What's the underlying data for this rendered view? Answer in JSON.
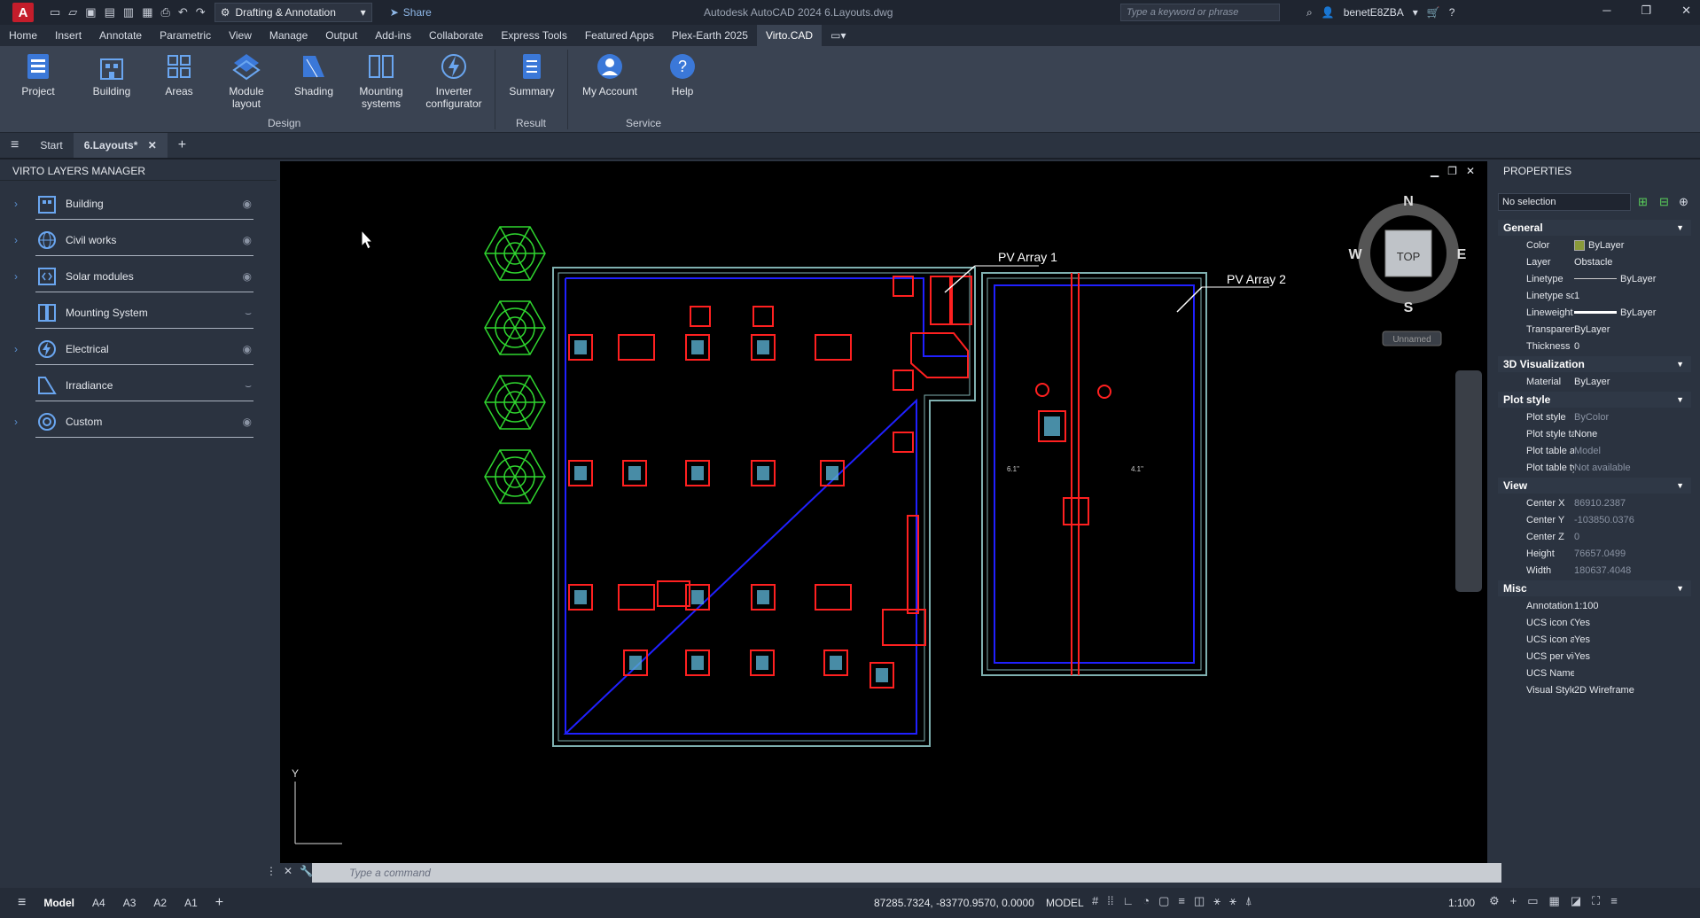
{
  "title_bar": {
    "logo_letter": "A",
    "workspace": "Drafting & Annotation",
    "share_label": "Share",
    "app_title": "Autodesk AutoCAD 2024   6.Layouts.dwg",
    "search_placeholder": "Type a keyword or phrase",
    "username": "benetE8ZBA"
  },
  "menu": [
    "Home",
    "Insert",
    "Annotate",
    "Parametric",
    "View",
    "Manage",
    "Output",
    "Add-ins",
    "Collaborate",
    "Express Tools",
    "Featured Apps",
    "Plex-Earth 2025",
    "Virto.CAD"
  ],
  "active_menu": "Virto.CAD",
  "ribbon": {
    "buttons": [
      {
        "label": "Project",
        "icon": "project-icon"
      },
      {
        "label": "Building",
        "icon": "building-icon"
      },
      {
        "label": "Areas",
        "icon": "areas-icon"
      },
      {
        "label": "Module\nlayout",
        "icon": "module-layout-icon"
      },
      {
        "label": "Shading",
        "icon": "shading-icon"
      },
      {
        "label": "Mounting\nsystems",
        "icon": "mounting-systems-icon"
      },
      {
        "label": "Inverter\nconfigurator",
        "icon": "inverter-icon"
      },
      {
        "label": "Summary",
        "icon": "summary-icon"
      },
      {
        "label": "My Account",
        "icon": "account-icon"
      },
      {
        "label": "Help",
        "icon": "help-icon"
      }
    ],
    "groups": [
      "Design",
      "Result",
      "Service"
    ]
  },
  "doc_tabs": {
    "start": "Start",
    "active": "6.Layouts*"
  },
  "layers_panel": {
    "title": "VIRTO LAYERS MANAGER",
    "items": [
      "Building",
      "Civil works",
      "Solar modules",
      "Mounting System",
      "Electrical",
      "Irradiance",
      "Custom"
    ]
  },
  "drawing": {
    "label1": "PV Array 1",
    "label2": "PV Array 2",
    "dim1": "6.1\"",
    "dim2": "4.1\""
  },
  "viewcube": {
    "n": "N",
    "s": "S",
    "e": "E",
    "w": "W",
    "face": "TOP",
    "ucs": "Unnamed"
  },
  "properties": {
    "title": "PROPERTIES",
    "selection": "No selection",
    "sections": {
      "general": "General",
      "vis3d": "3D Visualization",
      "plot": "Plot style",
      "view": "View",
      "misc": "Misc"
    },
    "rows": {
      "color": [
        "Color",
        "ByLayer"
      ],
      "layer": [
        "Layer",
        "Obstacle"
      ],
      "linetype": [
        "Linetype",
        "ByLayer"
      ],
      "linetype_scale": [
        "Linetype sca...",
        "1"
      ],
      "lineweight": [
        "Lineweight",
        "ByLayer"
      ],
      "transparency": [
        "Transparency",
        "ByLayer"
      ],
      "thickness": [
        "Thickness",
        "0"
      ],
      "material": [
        "Material",
        "ByLayer"
      ],
      "plot_style": [
        "Plot style",
        "ByColor"
      ],
      "plot_style_table": [
        "Plot style ta...",
        "None"
      ],
      "plot_table_at": [
        "Plot table at...",
        "Model"
      ],
      "plot_table_ty": [
        "Plot table ty...",
        "Not available"
      ],
      "center_x": [
        "Center X",
        "86910.2387"
      ],
      "center_y": [
        "Center Y",
        "-103850.0376"
      ],
      "center_z": [
        "Center Z",
        "0"
      ],
      "height": [
        "Height",
        "76657.0499"
      ],
      "width": [
        "Width",
        "180637.4048"
      ],
      "annotation": [
        "Annotation...",
        "1:100"
      ],
      "ucs_on": [
        "UCS icon On",
        "Yes"
      ],
      "ucs_at": [
        "UCS icon at...",
        "Yes"
      ],
      "ucs_per": [
        "UCS per vie...",
        "Yes"
      ],
      "ucs_name": [
        "UCS Name",
        ""
      ],
      "visual_style": [
        "Visual Style",
        "2D Wireframe"
      ]
    },
    "color_swatch": "#8a9a3a"
  },
  "command": {
    "placeholder": "Type a command"
  },
  "status": {
    "tabs": [
      "Model",
      "A4",
      "A3",
      "A2",
      "A1"
    ],
    "coords": "87285.7324, -83770.9570, 0.0000",
    "mode": "MODEL",
    "scale": "1:100"
  }
}
